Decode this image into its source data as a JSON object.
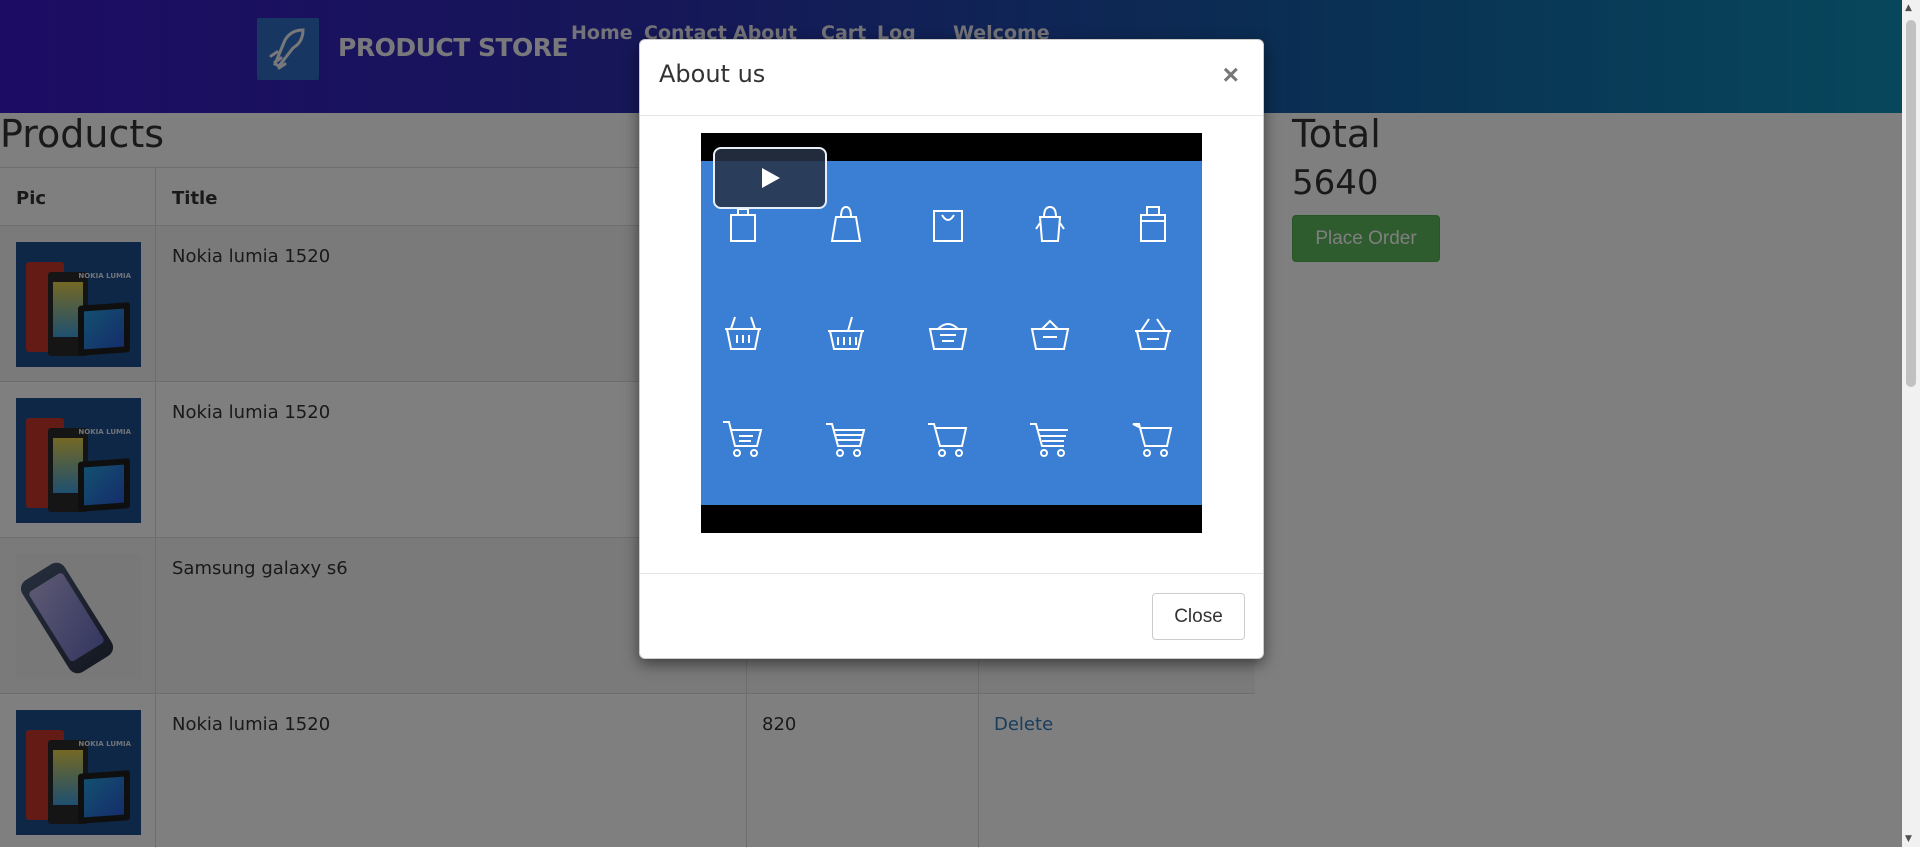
{
  "navbar": {
    "brand": "PRODUCT STORE",
    "links": [
      "Home",
      "Contact",
      "About",
      "Cart",
      "Log",
      "Welcome"
    ]
  },
  "page": {
    "products_title": "Products",
    "table_headers": [
      "Pic",
      "Title"
    ],
    "rows": [
      {
        "title": "Nokia lumia 1520",
        "price": "",
        "action": ""
      },
      {
        "title": "Nokia lumia 1520",
        "price": "",
        "action": ""
      },
      {
        "title": "Samsung galaxy s6",
        "price": "",
        "action": ""
      },
      {
        "title": "Nokia lumia 1520",
        "price": "820",
        "action": "Delete"
      }
    ],
    "total_label": "Total",
    "total_value": "5640",
    "place_order": "Place Order"
  },
  "modal": {
    "title": "About us",
    "close_x": "×",
    "close_label": "Close"
  },
  "icons": {
    "row1": [
      "shopping-bag-icon",
      "shopping-bag-icon",
      "shopping-bag-icon",
      "shopping-bag-icon",
      "shopping-bag-icon"
    ],
    "row2": [
      "basket-icon",
      "basket-icon",
      "basket-icon",
      "basket-icon",
      "basket-icon"
    ],
    "row3": [
      "cart-icon",
      "cart-icon",
      "cart-icon",
      "cart-icon",
      "cart-icon"
    ]
  },
  "colors": {
    "video_bg": "#3b7fd4",
    "order_button": "#5cb85c",
    "link": "#337ab7"
  }
}
